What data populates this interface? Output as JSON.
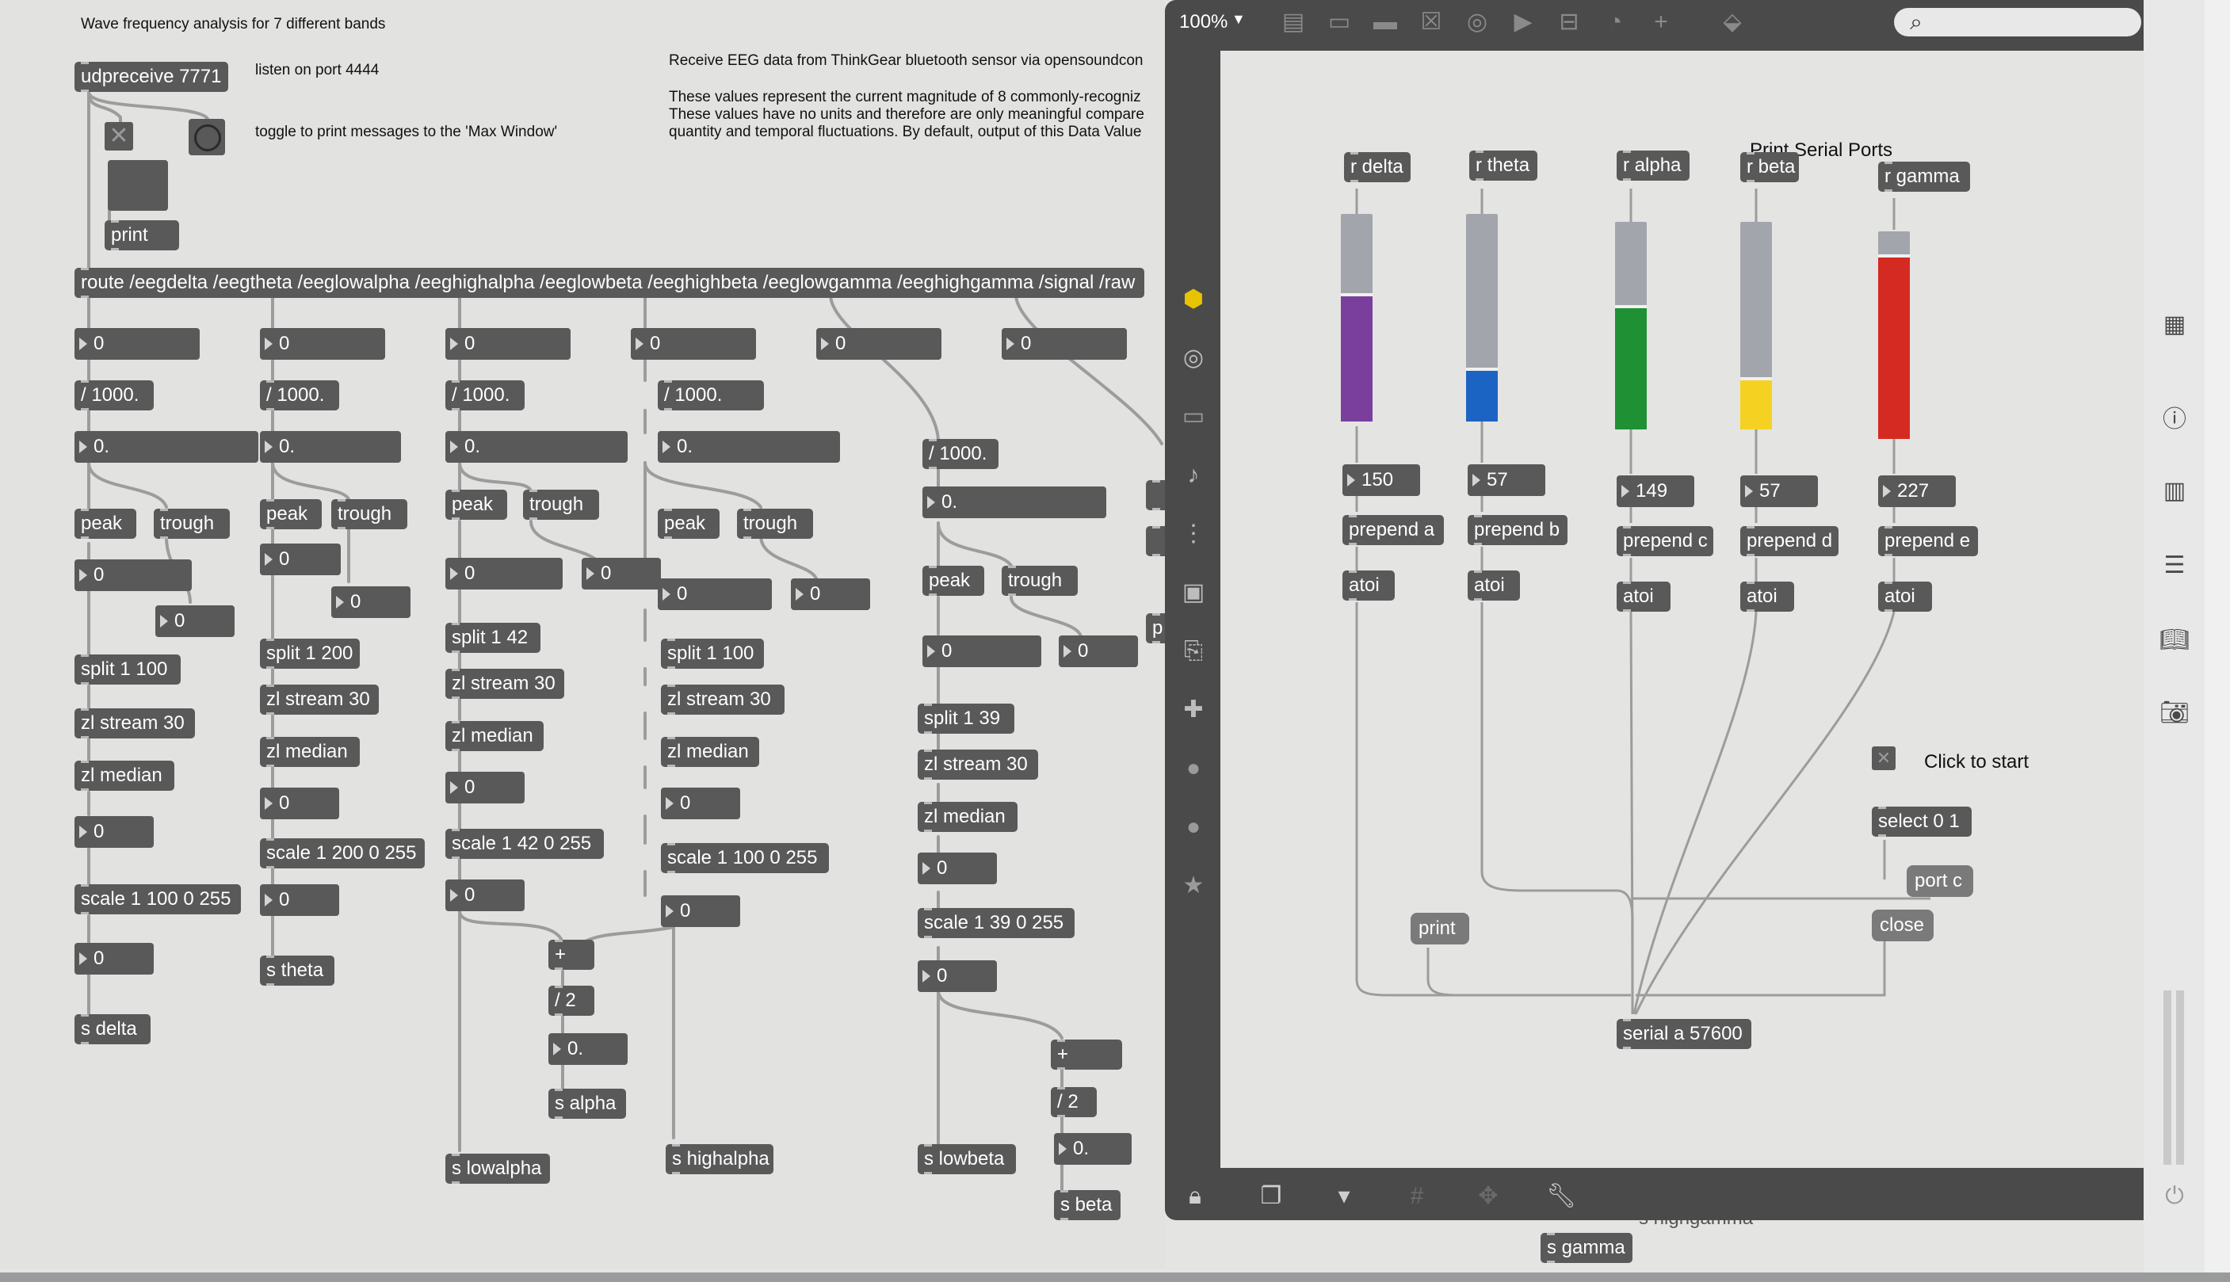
{
  "main_patch": {
    "title_comment": "Wave frequency analysis for 7 different bands",
    "listen_comment": "listen on port 4444",
    "toggle_comment": "toggle to print messages to the 'Max Window'",
    "receive_comment": "Receive EEG data from ThinkGear bluetooth sensor via opensoundcon",
    "values_comment_1": "These values represent the current magnitude of 8 commonly-recogniz",
    "values_comment_2": "These values have no units and therefore are only meaningful compare",
    "values_comment_3": "quantity and temporal fluctuations. By default, output of this Data Value",
    "udpreceive": "udpreceive 7771",
    "print": "print",
    "route": "route /eegdelta /eegtheta /eeglowalpha /eeghighalpha /eeglowbeta /eeghighbeta /eeglowgamma /eeghighgamma /signal /raw",
    "delta": {
      "num1": "0",
      "div": "/ 1000.",
      "float": "0.",
      "peak": "peak",
      "trough": "trough",
      "peak_num": "0",
      "trough_num": "0",
      "split": "split 1 100",
      "stream": "zl stream 30",
      "median": "zl median",
      "median_num": "0",
      "scale": "scale 1 100 0 255",
      "out_num": "0",
      "send": "s delta"
    },
    "theta": {
      "num1": "0",
      "div": "/ 1000.",
      "float": "0.",
      "peak": "peak",
      "trough": "trough",
      "peak_num": "0",
      "trough_num": "0",
      "split": "split 1 200",
      "stream": "zl stream 30",
      "median": "zl median",
      "median_num": "0",
      "scale": "scale 1 200 0 255",
      "out_num": "0",
      "send": "s theta"
    },
    "lowalpha": {
      "num1": "0",
      "div": "/ 1000.",
      "float": "0.",
      "peak": "peak",
      "trough": "trough",
      "peak_num": "0",
      "trough_num": "0",
      "split": "split 1 42",
      "stream": "zl stream 30",
      "median": "zl median",
      "median_num": "0",
      "scale": "scale 1 42 0 255",
      "out_num": "0",
      "send": "s lowalpha"
    },
    "highalpha": {
      "num1": "0",
      "div": "/ 1000.",
      "float": "0.",
      "peak": "peak",
      "trough": "trough",
      "peak_num": "0",
      "trough_num": "0",
      "split": "split 1 100",
      "stream": "zl stream 30",
      "median": "zl median",
      "median_num": "0",
      "scale": "scale 1 100 0 255",
      "out_num": "0",
      "send": "s highalpha"
    },
    "alpha": {
      "plus": "+",
      "div2": "/ 2",
      "float": "0.",
      "send": "s alpha"
    },
    "lowbeta": {
      "num0": "0",
      "div": "/ 1000.",
      "float": "0.",
      "peak": "peak",
      "trough": "trough",
      "peak_num": "0",
      "trough_num": "0",
      "split": "split 1 39",
      "stream": "zl stream 30",
      "median": "zl median",
      "median_num": "0",
      "scale": "scale 1 39 0 255",
      "out_num": "0",
      "send": "s lowbeta"
    },
    "highbeta": {
      "num0": "0"
    },
    "beta": {
      "plus": "+",
      "div2": "/ 2",
      "float": "0.",
      "send": "s beta"
    },
    "partial_p": "p",
    "gamma_send": "s gamma",
    "gamma_behind": "s highgamma"
  },
  "subpatch": {
    "zoom": "100%",
    "print_serial_ports": "Print Serial Ports",
    "click_to_start": "Click to start",
    "bands": [
      {
        "receive": "r delta",
        "value": "150",
        "prepend": "prepend a",
        "atoi": "atoi",
        "fill_pct": 0.62,
        "color": "#7a3f9d"
      },
      {
        "receive": "r theta",
        "value": "57",
        "prepend": "prepend b",
        "atoi": "atoi",
        "fill_pct": 0.26,
        "color": "#1c64c4"
      },
      {
        "receive": "r alpha",
        "value": "149",
        "prepend": "prepend c",
        "atoi": "atoi",
        "fill_pct": 0.6,
        "color": "#1f9134"
      },
      {
        "receive": "r beta",
        "value": "57",
        "prepend": "prepend d",
        "atoi": "atoi",
        "fill_pct": 0.25,
        "color": "#f5d222"
      },
      {
        "receive": "r gamma",
        "value": "227",
        "prepend": "prepend e",
        "atoi": "atoi",
        "fill_pct": 0.89,
        "color": "#d52a22"
      }
    ],
    "select": "select 0 1",
    "port": "port c",
    "close": "close",
    "print": "print",
    "serial": "serial a 57600"
  },
  "icons": {
    "toolbar": [
      "presentation-icon",
      "comment-icon",
      "message-icon",
      "toggle-icon",
      "bang-icon",
      "playbar-icon",
      "slider-icon",
      "dial-icon",
      "add-icon",
      "paint-icon"
    ],
    "sidebar": [
      "objects-icon",
      "audio-icon",
      "matrix-icon",
      "music-note-icon",
      "sequence-icon",
      "image-icon",
      "attachment-icon",
      "plugin-icon",
      "vimeo-icon",
      "bpatcher-icon",
      "favorite-icon"
    ],
    "bottom": [
      "lock-icon",
      "windows-icon",
      "presentation-icon",
      "grid-icon",
      "snap-icon",
      "wrench-icon"
    ],
    "right": [
      "grid-view-icon",
      "info-icon",
      "book-icon",
      "list-icon",
      "reference-icon",
      "camera-icon",
      "power-icon"
    ]
  }
}
